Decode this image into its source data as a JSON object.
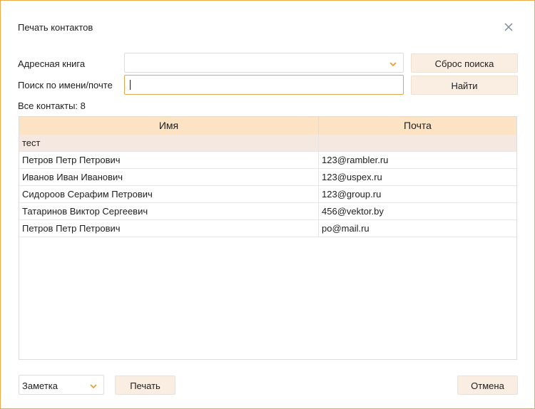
{
  "dialog": {
    "title": "Печать контактов",
    "close_icon": "close-icon"
  },
  "filters": {
    "address_book_label": "Адресная книга",
    "address_book_value": "",
    "search_label": "Поиск по имени/почте",
    "search_value": "",
    "reset_button": "Сброс поиска",
    "find_button": "Найти"
  },
  "contacts_count": "Все контакты: 8",
  "table": {
    "columns": [
      "Имя",
      "Почта"
    ],
    "rows": [
      {
        "name": "тест",
        "email": ""
      },
      {
        "name": "Петров Петр Петрович",
        "email": "123@rambler.ru"
      },
      {
        "name": "Иванов Иван Иванович",
        "email": "123@uspex.ru"
      },
      {
        "name": "Сидороов Серафим Петрович",
        "email": "123@group.ru"
      },
      {
        "name": "Татаринов Виктор Сергеевич",
        "email": "456@vektor.by"
      },
      {
        "name": "Петров Петр Петрович",
        "email": "po@mail.ru"
      }
    ]
  },
  "footer": {
    "format_value": "Заметка",
    "print_button": "Печать",
    "cancel_button": "Отмена"
  },
  "colors": {
    "accent": "#f0a94a",
    "header_bg": "#fce3c4",
    "button_bg": "#faeee2",
    "selected_row_bg": "#f5e8e0"
  }
}
